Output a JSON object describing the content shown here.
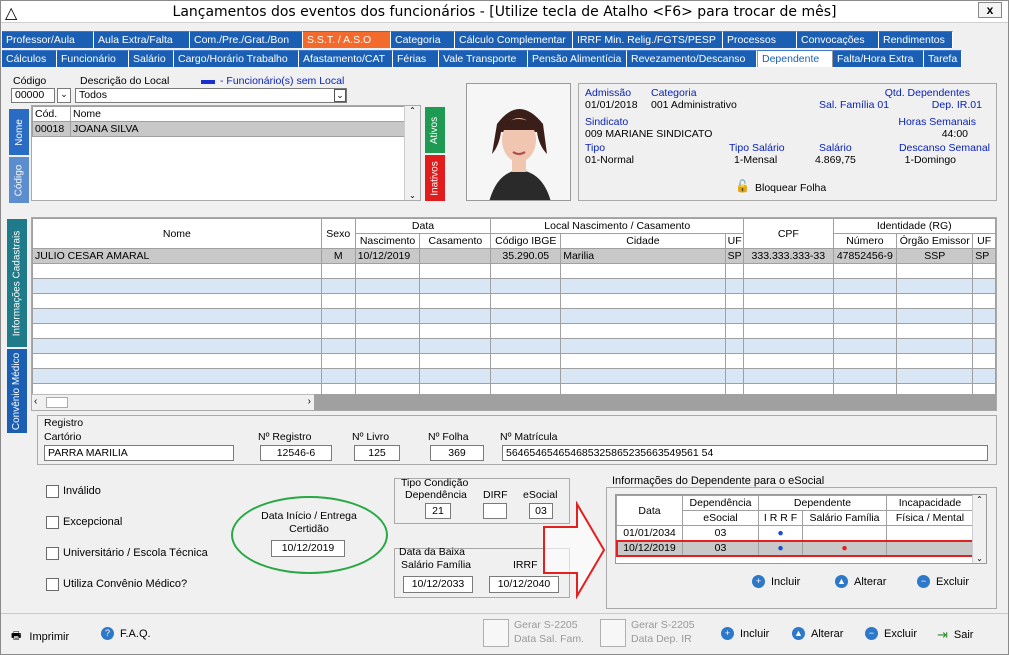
{
  "window": {
    "title": "Lançamentos dos eventos dos funcionários - [Utilize tecla de Atalho <F6> para trocar de mês]",
    "close": "x"
  },
  "tabs_row1": [
    {
      "label": "Professor/Aula",
      "w": 92
    },
    {
      "label": "Aula Extra/Falta",
      "w": 96
    },
    {
      "label": "Com./Pre./Grat./Bon",
      "w": 113
    },
    {
      "label": "S.S.T. / A.S.O",
      "w": 88,
      "style": "orange"
    },
    {
      "label": "Categoria",
      "w": 64
    },
    {
      "label": "Cálculo Complementar",
      "w": 118
    },
    {
      "label": "IRRF Min. Relig./FGTS/PESP",
      "w": 150
    },
    {
      "label": "Processos",
      "w": 74
    },
    {
      "label": "Convocações",
      "w": 82
    },
    {
      "label": "Rendimentos",
      "w": 74
    }
  ],
  "tabs_row2": [
    {
      "label": "Cálculos",
      "w": 55
    },
    {
      "label": "Funcionário",
      "w": 72
    },
    {
      "label": "Salário",
      "w": 45
    },
    {
      "label": "Cargo/Horário Trabalho",
      "w": 125
    },
    {
      "label": "Afastamento/CAT",
      "w": 94
    },
    {
      "label": "Férias",
      "w": 46
    },
    {
      "label": "Vale Transporte",
      "w": 89
    },
    {
      "label": "Pensão Alimentícia",
      "w": 99
    },
    {
      "label": "Revezamento/Descanso",
      "w": 130
    },
    {
      "label": "Dependente",
      "w": 76,
      "style": "active"
    },
    {
      "label": "Falta/Hora Extra",
      "w": 91
    },
    {
      "label": "Tarefa",
      "w": 38
    }
  ],
  "filter": {
    "codigo_label": "Código",
    "codigo_value": "00000",
    "descricao_label": "Descrição do Local",
    "descricao_value": "Todos",
    "legend": "- Funcionário(s) sem Local"
  },
  "employee_list": {
    "col_cod": "Cód.",
    "col_nome": "Nome",
    "rows": [
      {
        "cod": "00018",
        "nome": "JOANA SILVA"
      }
    ],
    "tab_nome": "Nome",
    "tab_codigo": "Código",
    "tab_ativos": "Ativos",
    "tab_inativos": "Inativos"
  },
  "info": {
    "admissao_label": "Admissão",
    "admissao": "01/01/2018",
    "categoria_label": "Categoria",
    "categoria": "001  Administrativo",
    "qtd_dep_label": "Qtd. Dependentes",
    "sal_familia": "Sal. Família 01",
    "dep_ir": "Dep. IR.01",
    "sindicato_label": "Sindicato",
    "sindicato": "009  MARIANE SINDICATO",
    "horas_label": "Horas Semanais",
    "horas": "44:00",
    "tipo_label": "Tipo",
    "tipo": "01-Normal",
    "tipo_salario_label": "Tipo Salário",
    "tipo_salario": "1-Mensal",
    "salario_label": "Salário",
    "salario": "4.869,75",
    "descanso_label": "Descanso Semanal",
    "descanso": "1-Domingo",
    "bloquear": "Bloquear Folha"
  },
  "side_tabs": {
    "info": "Informações Cadastrais",
    "convenio": "Convênio Médico"
  },
  "dependents": {
    "headers": {
      "nome": "Nome",
      "sexo": "Sexo",
      "data": "Data",
      "nascimento": "Nascimento",
      "casamento": "Casamento",
      "local": "Local Nascimento / Casamento",
      "ibge": "Código IBGE",
      "cidade": "Cidade",
      "uf": "UF",
      "cpf": "CPF",
      "identidade": "Identidade (RG)",
      "numero": "Número",
      "orgao": "Órgão Emissor",
      "uf2": "UF"
    },
    "rows": [
      {
        "nome": "JULIO CESAR AMARAL",
        "sexo": "M",
        "nascimento": "10/12/2019",
        "casamento": "",
        "ibge": "35.290.05",
        "cidade": "Marilia",
        "uf": "SP",
        "cpf": "333.333.333-33",
        "numero": "47852456-9",
        "orgao": "SSP",
        "uf2": "SP"
      }
    ]
  },
  "registro": {
    "title": "Registro",
    "cartorio_label": "Cartório",
    "cartorio": "PARRA MARILIA",
    "nreg_label": "Nº Registro",
    "nreg": "12546-6",
    "nlivro_label": "Nº Livro",
    "nlivro": "125",
    "nfolha_label": "Nº Folha",
    "nfolha": "369",
    "nmatricula_label": "Nº Matrícula",
    "nmatricula": "564654654654685325865235663549561 54"
  },
  "checks": {
    "invalido": "Inválido",
    "excepcional": "Excepcional",
    "universitario": "Universitário / Escola Técnica",
    "convenio": "Utiliza Convênio Médico?"
  },
  "certidao": {
    "label1": "Data Início / Entrega",
    "label2": "Certidão",
    "value": "10/12/2019"
  },
  "tipo_condicao": {
    "title": "Tipo Condição",
    "dependencia_label": "Dependência",
    "dependencia": "21",
    "dirf_label": "DIRF",
    "dirf": "",
    "esocial_label": "eSocial",
    "esocial": "03"
  },
  "baixa": {
    "title": "Data da Baixa",
    "salfam_label": "Salário Família",
    "salfam": "10/12/2033",
    "irrf_label": "IRRF",
    "irrf": "10/12/2040"
  },
  "esocial_info": {
    "title": "Informações do Dependente para o eSocial",
    "h_data": "Data",
    "h_dependencia": "Dependência",
    "h_esocial": "eSocial",
    "h_dependente": "Dependente",
    "h_irrf": "I R R F",
    "h_salfam": "Salário Família",
    "h_incap": "Incapacidade",
    "h_fisica": "Física / Mental",
    "rows": [
      {
        "data": "01/01/2034",
        "esocial": "03",
        "irrf": "●",
        "salfam": ""
      },
      {
        "data": "10/12/2019",
        "esocial": "03",
        "irrf": "●",
        "salfam": "●"
      }
    ],
    "incluir": "Incluir",
    "alterar": "Alterar",
    "excluir": "Excluir"
  },
  "footer": {
    "imprimir": "Imprimir",
    "faq": "F.A.Q.",
    "gerar1_line1": "Gerar S-2205",
    "gerar1_line2": "Data Sal. Fam.",
    "gerar2_line1": "Gerar S-2205",
    "gerar2_line2": "Data Dep. IR",
    "incluir": "Incluir",
    "alterar": "Alterar",
    "excluir": "Excluir",
    "sair": "Sair"
  },
  "colors": {
    "tab_blue": "#1a5fb4",
    "tab_orange": "#f26a2c",
    "highlight_green": "#27a844",
    "highlight_red": "#e32020",
    "label_blue": "#0a22b8"
  }
}
